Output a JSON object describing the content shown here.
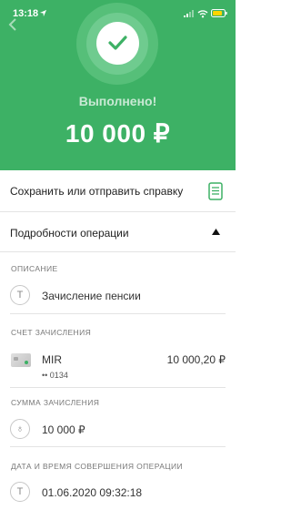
{
  "status_bar": {
    "time": "13:18"
  },
  "colors": {
    "accent": "#3db165",
    "background": "#ffffff"
  },
  "hero": {
    "status": "Выполнено!",
    "amount": "10 000 ₽"
  },
  "actions": {
    "save_label": "Сохранить или отправить справку"
  },
  "details": {
    "header": "Подробности операции",
    "description": {
      "label": "ОПИСАНИЕ",
      "icon_glyph": "T",
      "value": "Зачисление пенсии"
    },
    "account": {
      "label": "СЧЕТ ЗАЧИСЛЕНИЯ",
      "card_name": "MIR",
      "card_number": "•• 0134",
      "balance": "10 000,20 ₽"
    },
    "amount": {
      "label": "СУММА ЗАЧИСЛЕНИЯ",
      "icon_glyph": "♁",
      "value": "10 000 ₽"
    },
    "datetime": {
      "label": "ДАТА И ВРЕМЯ СОВЕРШЕНИЯ ОПЕРАЦИИ",
      "icon_glyph": "T",
      "value": "01.06.2020 09:32:18"
    }
  }
}
